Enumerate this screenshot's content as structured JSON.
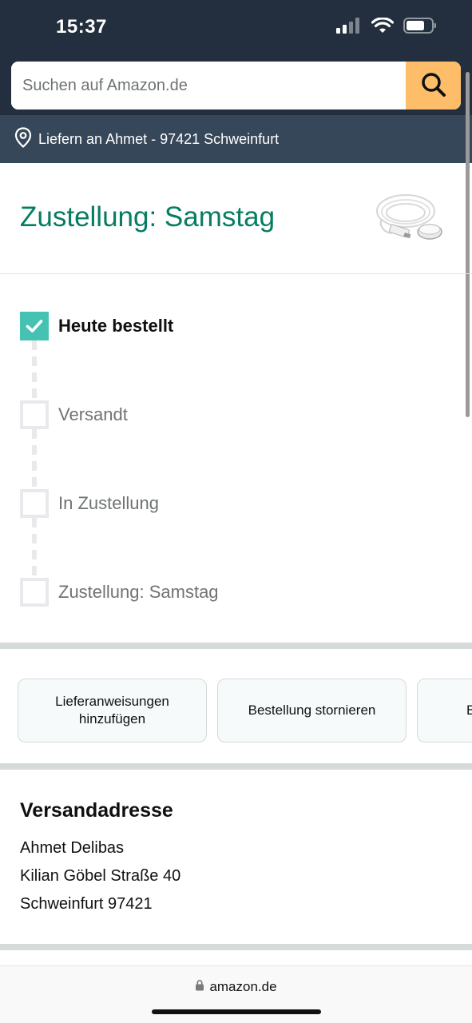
{
  "status": {
    "time": "15:37"
  },
  "search": {
    "placeholder": "Suchen auf Amazon.de"
  },
  "deliver": {
    "text": "Liefern an Ahmet - 97421 Schweinfurt"
  },
  "delivery": {
    "title": "Zustellung: Samstag"
  },
  "timeline": {
    "steps": [
      {
        "label": "Heute bestellt",
        "done": true
      },
      {
        "label": "Versandt",
        "done": false
      },
      {
        "label": "In Zustellung",
        "done": false
      },
      {
        "label": "Zustellung: Samstag",
        "done": false
      }
    ]
  },
  "actions": {
    "buttons": [
      {
        "label": "Lieferanweisungen hinzufügen"
      },
      {
        "label": "Bestellung stornieren"
      },
      {
        "label": "B"
      }
    ]
  },
  "address": {
    "heading": "Versandadresse",
    "lines": [
      "Ahmet Delibas",
      "Kilian Göbel Straße 40",
      "Schweinfurt 97421"
    ]
  },
  "browser": {
    "url": "amazon.de"
  },
  "colors": {
    "header_bg": "#232f3e",
    "deliver_bar_bg": "#37475a",
    "search_button": "#febd69",
    "title_green": "#067d62",
    "check_teal": "#46c2b2"
  }
}
